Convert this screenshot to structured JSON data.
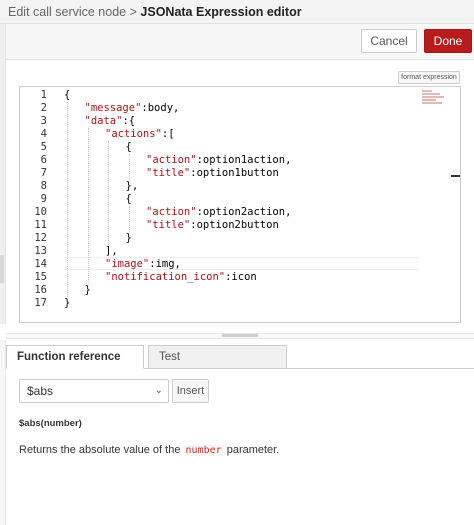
{
  "header": {
    "breadcrumb": "Edit call service node",
    "separator": ">",
    "title": "JSONata Expression editor"
  },
  "toolbar": {
    "cancel_label": "Cancel",
    "done_label": "Done"
  },
  "editor": {
    "format_label": "format expression",
    "lines": [
      {
        "n": "1",
        "parts": [
          {
            "t": "{",
            "c": "p"
          }
        ]
      },
      {
        "n": "2",
        "parts": [
          {
            "t": "\"message\"",
            "c": "k"
          },
          {
            "t": ":body,",
            "c": "p"
          }
        ]
      },
      {
        "n": "3",
        "parts": [
          {
            "t": "\"data\"",
            "c": "k"
          },
          {
            "t": ":{",
            "c": "p"
          }
        ]
      },
      {
        "n": "4",
        "parts": [
          {
            "t": "\"actions\"",
            "c": "k"
          },
          {
            "t": ":[",
            "c": "p"
          }
        ]
      },
      {
        "n": "5",
        "parts": [
          {
            "t": "{",
            "c": "p"
          }
        ]
      },
      {
        "n": "6",
        "parts": [
          {
            "t": "\"action\"",
            "c": "k"
          },
          {
            "t": ":option1action,",
            "c": "p"
          }
        ]
      },
      {
        "n": "7",
        "parts": [
          {
            "t": "\"title\"",
            "c": "k"
          },
          {
            "t": ":option1button",
            "c": "p"
          }
        ]
      },
      {
        "n": "8",
        "parts": [
          {
            "t": "},",
            "c": "p"
          }
        ]
      },
      {
        "n": "9",
        "parts": [
          {
            "t": "{",
            "c": "p"
          }
        ]
      },
      {
        "n": "10",
        "parts": [
          {
            "t": "\"action\"",
            "c": "k"
          },
          {
            "t": ":option2action,",
            "c": "p"
          }
        ]
      },
      {
        "n": "11",
        "parts": [
          {
            "t": "\"title\"",
            "c": "k"
          },
          {
            "t": ":option2button",
            "c": "p"
          }
        ]
      },
      {
        "n": "12",
        "parts": [
          {
            "t": "}",
            "c": "p"
          }
        ]
      },
      {
        "n": "13",
        "parts": [
          {
            "t": "],",
            "c": "p"
          }
        ]
      },
      {
        "n": "14",
        "parts": [
          {
            "t": "\"image\"",
            "c": "k"
          },
          {
            "t": ":img,",
            "c": "p"
          }
        ]
      },
      {
        "n": "15",
        "parts": [
          {
            "t": "\"notification_icon\"",
            "c": "k"
          },
          {
            "t": ":icon",
            "c": "p"
          }
        ]
      },
      {
        "n": "16",
        "parts": [
          {
            "t": "}",
            "c": "p"
          }
        ]
      },
      {
        "n": "17",
        "parts": [
          {
            "t": "}",
            "c": "p"
          }
        ]
      }
    ]
  },
  "tabs": {
    "function_reference": "Function reference",
    "test": "Test"
  },
  "function_panel": {
    "selected_function": "$abs",
    "insert_label": "Insert",
    "signature": "$abs(number)",
    "description_before": "Returns the absolute value of the",
    "description_code": "number",
    "description_after": "parameter."
  },
  "colors": {
    "done_button": "#b71c1c",
    "string_key": "#a31515",
    "inline_code": "#c0392b"
  }
}
